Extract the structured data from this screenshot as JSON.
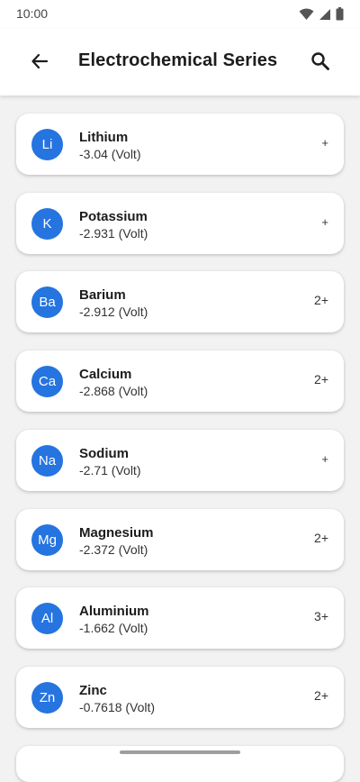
{
  "status_bar": {
    "time": "10:00",
    "icons": [
      "wifi-icon",
      "signal-icon",
      "battery-icon"
    ]
  },
  "app_bar": {
    "title": "Electrochemical Series",
    "back_icon": "arrow-back-icon",
    "search_icon": "search-icon"
  },
  "colors": {
    "accent": "#2574e0",
    "background": "#f2f2f2",
    "card": "#ffffff"
  },
  "elements": [
    {
      "symbol": "Li",
      "name": "Lithium",
      "potential": "-3.04 (Volt)",
      "charge": "+"
    },
    {
      "symbol": "K",
      "name": "Potassium",
      "potential": "-2.931 (Volt)",
      "charge": "+"
    },
    {
      "symbol": "Ba",
      "name": "Barium",
      "potential": "-2.912 (Volt)",
      "charge": "2+"
    },
    {
      "symbol": "Ca",
      "name": "Calcium",
      "potential": "-2.868 (Volt)",
      "charge": "2+"
    },
    {
      "symbol": "Na",
      "name": "Sodium",
      "potential": "-2.71 (Volt)",
      "charge": "+"
    },
    {
      "symbol": "Mg",
      "name": "Magnesium",
      "potential": "-2.372 (Volt)",
      "charge": "2+"
    },
    {
      "symbol": "Al",
      "name": "Aluminium",
      "potential": "-1.662 (Volt)",
      "charge": "3+"
    },
    {
      "symbol": "Zn",
      "name": "Zinc",
      "potential": "-0.7618 (Volt)",
      "charge": "2+"
    }
  ]
}
